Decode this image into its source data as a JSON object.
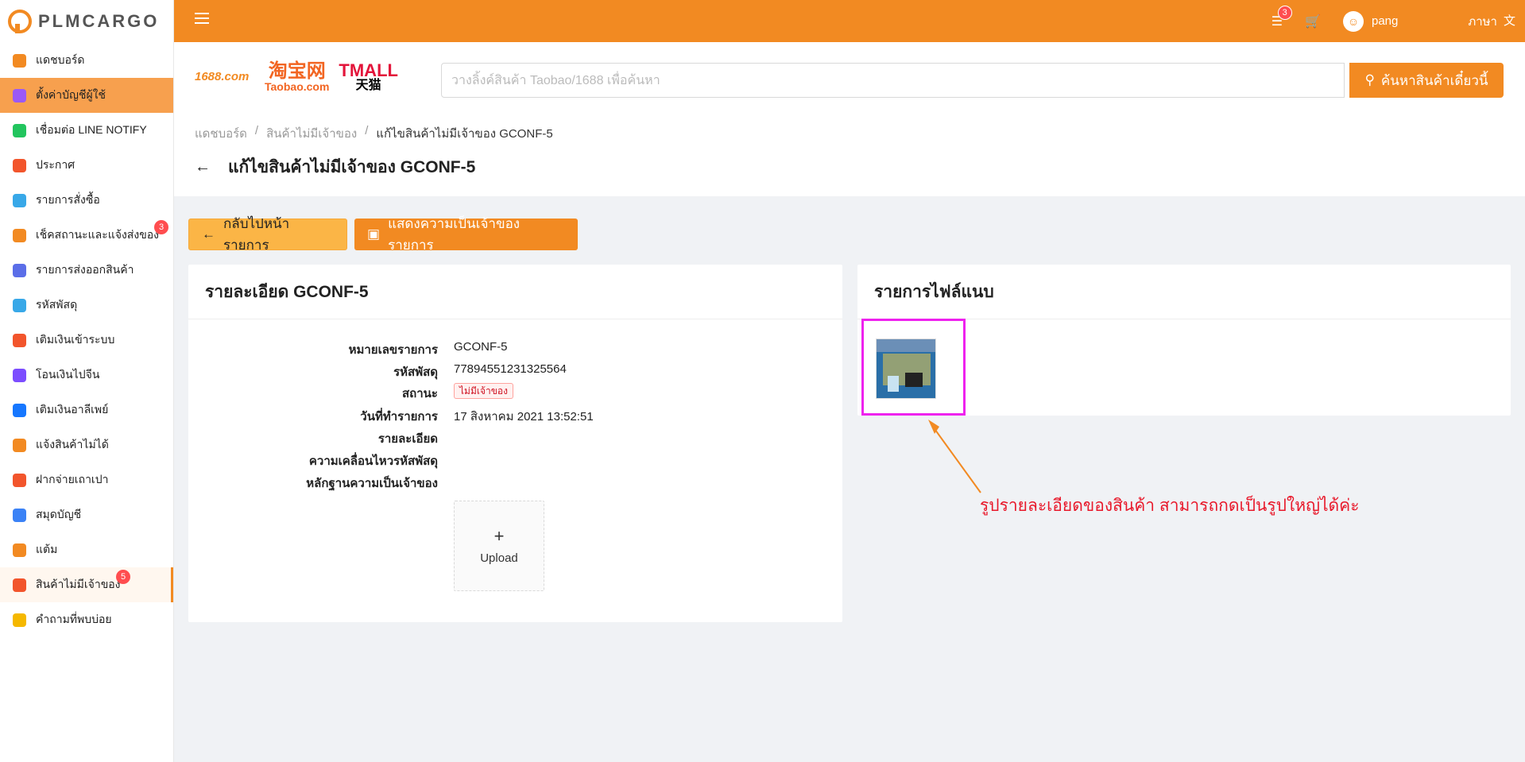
{
  "app": {
    "logo_text": "PLMCARGO"
  },
  "sidebar": {
    "items": [
      {
        "label": "แดชบอร์ด",
        "icon": "chart-icon",
        "color": "#f28a22"
      },
      {
        "label": "ตั้งค่าบัญชีผู้ใช้",
        "icon": "user-settings-icon",
        "color": "#9b59f6",
        "active": true
      },
      {
        "label": "เชื่อมต่อ LINE NOTIFY",
        "icon": "line-icon",
        "color": "#22c55e"
      },
      {
        "label": "ประกาศ",
        "icon": "megaphone-icon",
        "color": "#f2552c"
      },
      {
        "label": "รายการสั่งซื้อ",
        "icon": "basket-icon",
        "color": "#38a8e8"
      },
      {
        "label": "เช็คสถานะและแจ้งส่งของ",
        "icon": "truck-icon",
        "color": "#f28a22",
        "badge": "3"
      },
      {
        "label": "รายการส่งออกสินค้า",
        "icon": "dolly-icon",
        "color": "#5b6ee8"
      },
      {
        "label": "รหัสพัสดุ",
        "icon": "box-icon",
        "color": "#38a8e8"
      },
      {
        "label": "เติมเงินเข้าระบบ",
        "icon": "piggy-icon",
        "color": "#f2552c"
      },
      {
        "label": "โอนเงินไปจีน",
        "icon": "yuan-icon",
        "color": "#7c4dff"
      },
      {
        "label": "เติมเงินอาลีเพย์",
        "icon": "alipay-icon",
        "color": "#1677ff"
      },
      {
        "label": "แจ้งสินค้าไม่ได้",
        "icon": "no-box-icon",
        "color": "#f28a22"
      },
      {
        "label": "ฝากจ่ายเถาเปา",
        "icon": "taobao-icon",
        "color": "#f2552c"
      },
      {
        "label": "สมุดบัญชี",
        "icon": "wallet-icon",
        "color": "#3b82f6"
      },
      {
        "label": "แต้ม",
        "icon": "medal-icon",
        "color": "#f28a22"
      },
      {
        "label": "สินค้าไม่มีเจ้าของ",
        "icon": "search-box-icon",
        "color": "#f2552c",
        "badge": "5",
        "current": true
      },
      {
        "label": "คำถามที่พบบ่อย",
        "icon": "question-icon",
        "color": "#f5b800"
      }
    ]
  },
  "topbar": {
    "notification_badge": "3",
    "username": "pang",
    "language_label": "ภาษา"
  },
  "brands": {
    "b1688": "1688.com",
    "taobao": "淘宝网",
    "taobao_sub": "Taobao.com",
    "tmall": "TMALL",
    "tmall_sub": "天猫"
  },
  "search": {
    "placeholder": "วางลิ้งค์สินค้า Taobao/1688 เพื่อค้นหา",
    "button_label": "ค้นหาสินค้าเดี๋ยวนี้"
  },
  "breadcrumb": [
    "แดชบอร์ด",
    "สินค้าไม่มีเจ้าของ",
    "แก้ไขสินค้าไม่มีเจ้าของ GCONF-5"
  ],
  "page_title": "แก้ไขสินค้าไม่มีเจ้าของ GCONF-5",
  "actions": {
    "back_label": "กลับไปหน้ารายการ",
    "claim_label": "แสดงความเป็นเจ้าของรายการ"
  },
  "detail": {
    "title": "รายละเอียด GCONF-5",
    "fields": [
      {
        "label": "หมายเลขรายการ",
        "value": "GCONF-5"
      },
      {
        "label": "รหัสพัสดุ",
        "value": "77894551231325564"
      },
      {
        "label": "สถานะ",
        "value": "ไม่มีเจ้าของ"
      },
      {
        "label": "วันที่ทำรายการ",
        "value": "17 สิงหาคม 2021 13:52:51"
      },
      {
        "label": "รายละเอียด",
        "value": ""
      },
      {
        "label": "ความเคลื่อนไหวรหัสพัสดุ",
        "value": ""
      },
      {
        "label": "หลักฐานความเป็นเจ้าของ",
        "value": ""
      }
    ],
    "upload_label": "Upload"
  },
  "attachments": {
    "title": "รายการไฟล์แนบ"
  },
  "annotation": "รูปรายละเอียดของสินค้า สามารถกดเป็นรูปใหญ่ได้ค่ะ",
  "colors": {
    "primary": "#f28a22",
    "annotation": "#e8182a",
    "highlight": "#ee22ee"
  }
}
